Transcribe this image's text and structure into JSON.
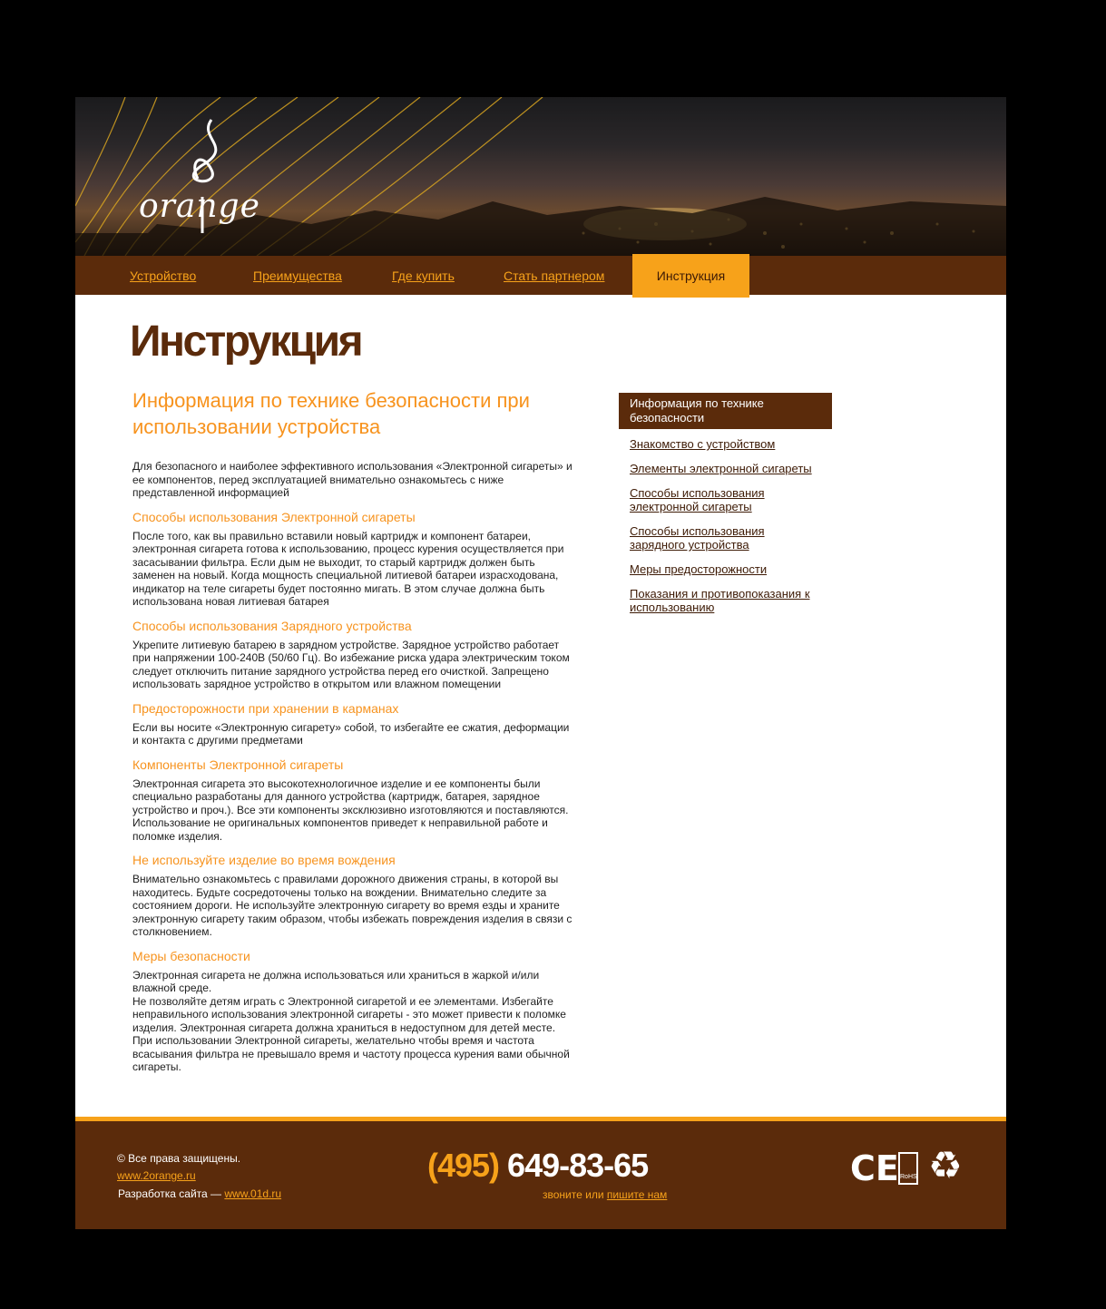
{
  "logo": {
    "text": "orange"
  },
  "nav": {
    "items": [
      {
        "label": "Устройство"
      },
      {
        "label": "Преимущества"
      },
      {
        "label": "Где купить"
      },
      {
        "label": "Стать партнером"
      },
      {
        "label": "Инструкция",
        "active": true
      }
    ]
  },
  "page": {
    "title": "Инструкция",
    "heading": "Информация по технике безопасности при использовании устройства",
    "intro": "Для безопасного и наиболее эффективного использования «Электронной сигареты» и ее компонентов, перед эксплуатацией   внимательно ознакомьтесь с ниже представленной информацией",
    "sections": [
      {
        "title": "Способы  использования Электронной сигареты",
        "text": "После того, как вы правильно вставили новый картридж и компонент батареи, электронная сигарета готова к использованию, процесс курения осуществляется при засасывании фильтра. Если дым не выходит,  то старый картридж должен быть заменен на новый. Когда мощность специальной литиевой батареи израсходована, индикатор на теле сигареты будет постоянно мигать. В этом случае должна  быть использована новая литиевая батарея"
      },
      {
        "title": "Способы  использования Зарядного устройства",
        "text": "Укрепите литиевую батарею в зарядном устройстве. Зарядное устройство работает при напряжении 100-240В (50/60 Гц). Во избежание риска удара электрическим током следует отключить питание зарядного устройства перед его очисткой. Запрещено использовать зарядное устройство в открытом или влажном помещении"
      },
      {
        "title": "Предосторожности при хранении в карманах",
        "text": "Если вы носите «Электронную сигарету» собой, то избегайте ее сжатия, деформации и контакта с другими предметами"
      },
      {
        "title": "Компоненты Электронной сигареты",
        "text": "Электронная сигарета это высокотехнологичное изделие и ее компоненты были специально разработаны для данного устройства (картридж, батарея, зарядное устройство и проч.). Все эти компоненты эксклюзивно изготовляются и поставляются. Использование не оригинальных компонентов приведет к неправильной работе и поломке изделия."
      },
      {
        "title": "Не используйте изделие во время вождения",
        "text": "Внимательно ознакомьтесь с правилами дорожного движения  страны, в которой вы находитесь. Будьте сосредоточены только на вождении. Внимательно следите за состоянием дороги. Не используйте электронную сигарету во время езды и храните электронную сигарету таким образом, чтобы избежать повреждения изделия в связи с столкновением."
      },
      {
        "title": "Меры безопасности",
        "text": "Электронная сигарета не должна использоваться или храниться в жаркой и/или влажной среде.\nНе позволяйте детям играть с Электронной сигаретой и ее элементами. Избегайте неправильного использования электронной сигареты - это может привести к поломке изделия. Электронная сигарета должна храниться в недоступном для детей месте.\nПри использовании Электронной сигареты, желательно чтобы время и частота всасывания фильтра не превышало время и частоту процесса курения вами обычной сигареты."
      }
    ]
  },
  "side": {
    "active": "Информация по технике безопасности",
    "links": [
      "Знакомство с устройством",
      "Элементы электронной сигареты",
      "Способы использования электронной сигареты",
      "Способы использования зарядного устройства",
      "Меры предосторожности",
      "Показания и противопоказания к использованию"
    ]
  },
  "footer": {
    "copyright": "© Все права защищены.",
    "site": "www.2orange.ru",
    "dev_prefix": "Разработка  сайта — ",
    "dev_link": "www.01d.ru",
    "phone_code": "(495)",
    "phone_number": " 649-83-65",
    "call_prefix": "звоните или ",
    "call_link": "пишите нам",
    "cert_ce": "CE",
    "cert_rohs": "RoHS",
    "cert_recycle": "♻"
  },
  "colors": {
    "brown": "#5b2b0b",
    "orange": "#f7a21a",
    "heading_orange": "#f7931e"
  }
}
